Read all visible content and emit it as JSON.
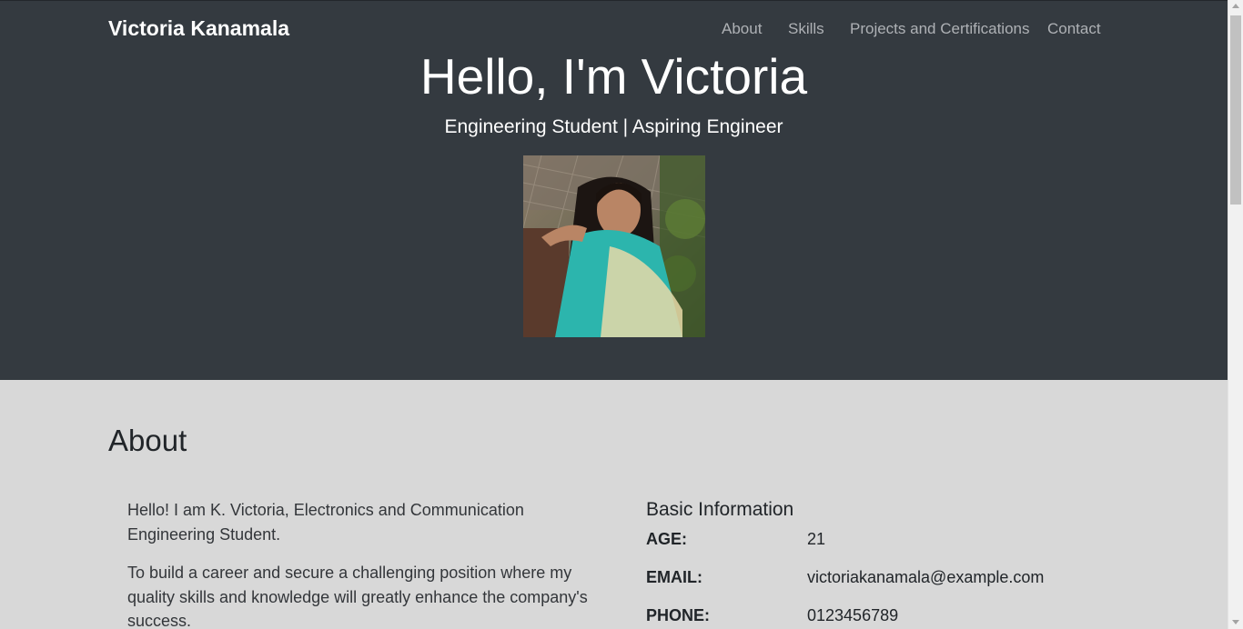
{
  "navbar": {
    "brand": "Victoria Kanamala",
    "links": [
      {
        "label": "About"
      },
      {
        "label": "Skills"
      },
      {
        "label": "Projects and Certifications"
      },
      {
        "label": "Contact"
      }
    ]
  },
  "hero": {
    "title": "Hello, I'm Victoria",
    "subtitle": "Engineering Student | Aspiring Engineer",
    "photo_icon": "profile-photo",
    "background_color": "#343a40"
  },
  "about": {
    "heading": "About",
    "paragraphs": [
      "Hello! I am K. Victoria, Electronics and Communication Engineering Student.",
      "To build a career and secure a challenging position where my quality skills and knowledge will greatly enhance the company's success."
    ],
    "basic_info": {
      "heading": "Basic Information",
      "rows": [
        {
          "key": "AGE:",
          "value": "21"
        },
        {
          "key": "EMAIL:",
          "value": "victoriakanamala@example.com"
        },
        {
          "key": "PHONE:",
          "value": "0123456789"
        }
      ]
    }
  }
}
